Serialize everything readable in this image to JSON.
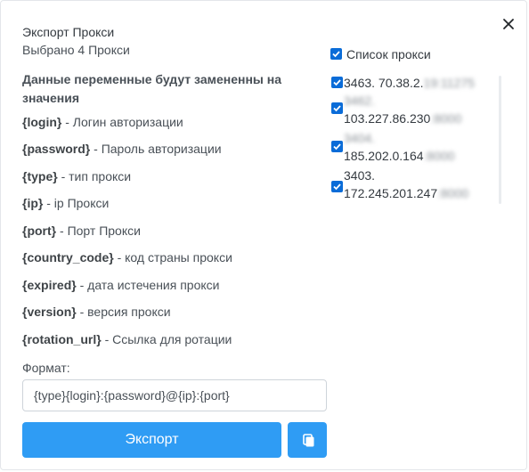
{
  "modal": {
    "title": "Экспорт Прокси",
    "subtitle": "Выбрано 4 Прокси",
    "section_heading": "Данные переменные будут замененны на значения",
    "variables": [
      {
        "key": "{login}",
        "desc": "- Логин авторизации"
      },
      {
        "key": "{password}",
        "desc": "- Пароль авторизации"
      },
      {
        "key": "{type}",
        "desc": "- тип прокси"
      },
      {
        "key": "{ip}",
        "desc": "- ip Прокси"
      },
      {
        "key": "{port}",
        "desc": "- Порт Прокси"
      },
      {
        "key": "{country_code}",
        "desc": "- код страны прокси"
      },
      {
        "key": "{expired}",
        "desc": "- дата истечения прокси"
      },
      {
        "key": "{version}",
        "desc": "- версия прокси"
      },
      {
        "key": "{rotation_url}",
        "desc": "- Ссылка для ротации"
      }
    ],
    "format_label": "Формат:",
    "format_value": "{type}{login}:{password}@{ip}:{port}",
    "export_label": "Экспорт",
    "copy_icon": "copy-icon",
    "close_icon": "close-icon"
  },
  "proxy_list": {
    "header_label": "Список прокси",
    "header_checked": true,
    "items": [
      {
        "line1": "3463. 70.38.2.",
        "line1_hidden": "19:11275",
        "line2": "",
        "line2_hidden": "",
        "checked": true
      },
      {
        "line1": "3462.",
        "line1_hidden": "",
        "line2": "103.227.86.230",
        "line2_hidden": ":8000",
        "checked": true
      },
      {
        "line1": "3404.",
        "line1_hidden": "",
        "line2": "185.202.0.164",
        "line2_hidden": ":8000",
        "checked": true
      },
      {
        "line1": "3403.",
        "line1_hidden": "",
        "line2": "172.245.201.247",
        "line2_hidden": ":8000",
        "checked": true
      }
    ]
  },
  "colors": {
    "primary": "#2f9cf4",
    "checkbox": "#0a6cd8",
    "text": "#343a40"
  }
}
